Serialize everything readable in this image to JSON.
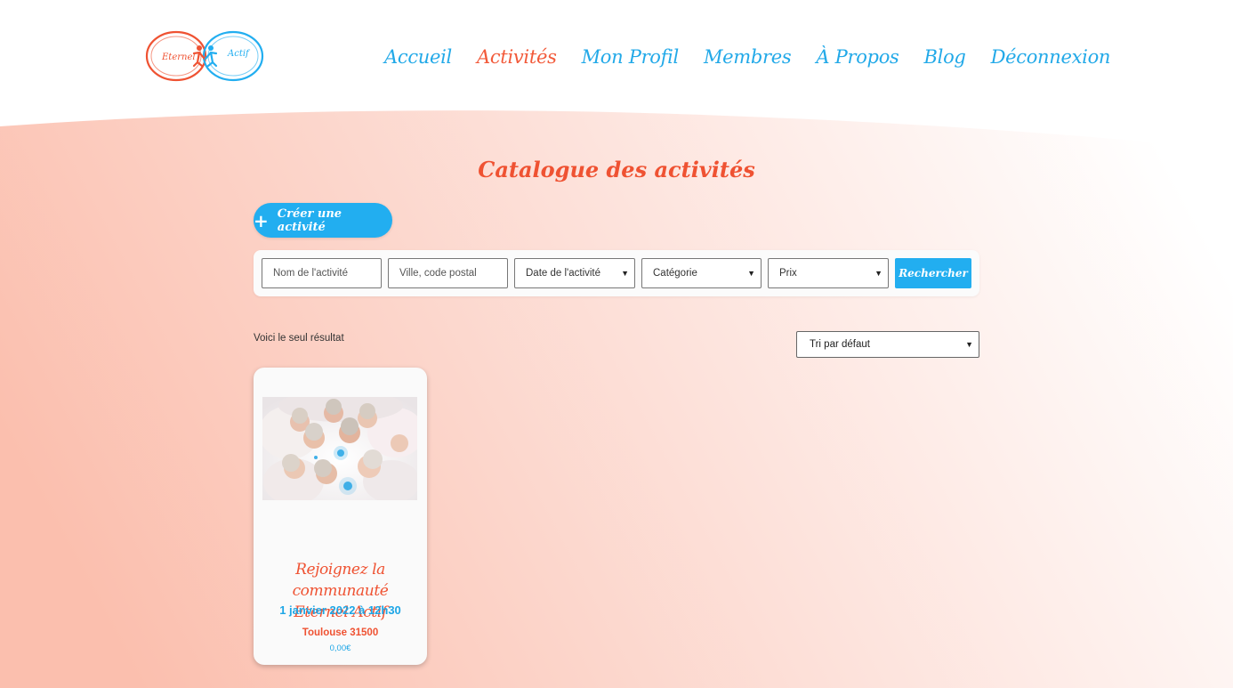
{
  "brand": {
    "logo_word1": "Eternel",
    "logo_word2": "Actif",
    "color_orange": "#ef5232",
    "color_blue": "#22aef0"
  },
  "nav": {
    "items": [
      {
        "label": "Accueil",
        "active": false
      },
      {
        "label": "Activités",
        "active": true
      },
      {
        "label": "Mon Profil",
        "active": false
      },
      {
        "label": "Membres",
        "active": false
      },
      {
        "label": "À Propos",
        "active": false
      },
      {
        "label": "Blog",
        "active": false
      },
      {
        "label": "Déconnexion",
        "active": false
      }
    ]
  },
  "page": {
    "title": "Catalogue des activités",
    "create_button": "Créer une activité",
    "create_icon": "plus-icon"
  },
  "filters": {
    "name_placeholder": "Nom de l'activité",
    "city_placeholder": "Ville, code postal",
    "date_selected": "Date de l'activité",
    "category_selected": "Catégorie",
    "price_selected": "Prix",
    "search_button": "Rechercher"
  },
  "results": {
    "summary": "Voici le seul résultat",
    "sort_selected": "Tri par défaut"
  },
  "activities": [
    {
      "title_line1": "Rejoignez la communauté",
      "title_line2": "Eternel Actif",
      "date": "1 janvier 2022 à 12h30",
      "city": "Toulouse 31500",
      "price": "0,00€",
      "image": "group-of-seniors-photo"
    }
  ]
}
